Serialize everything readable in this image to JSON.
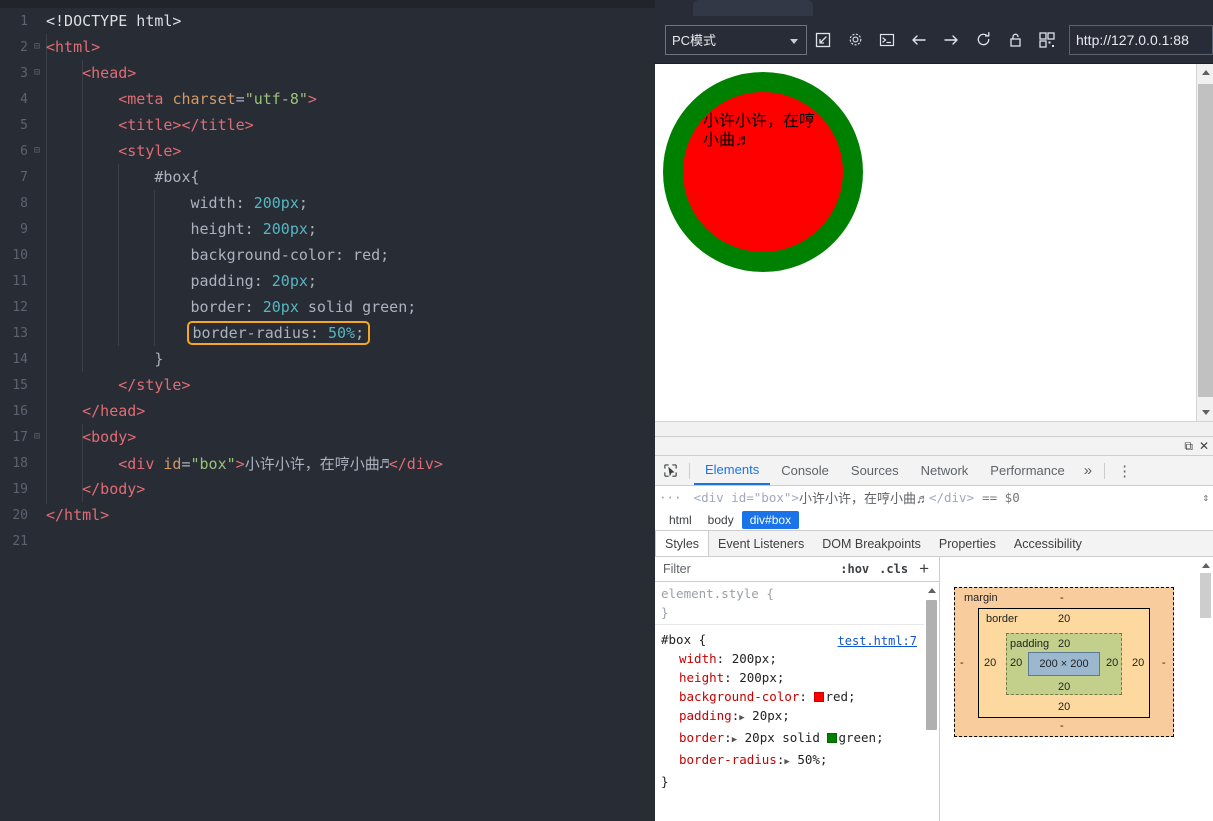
{
  "editor": {
    "lines": [
      {
        "n": "1",
        "fold": "",
        "html": "<span class=\"t-white\">&lt;!DOCTYPE html&gt;</span>"
      },
      {
        "n": "2",
        "fold": "⊟",
        "html": "<span class=\"t-tag\">&lt;html&gt;</span>"
      },
      {
        "n": "3",
        "fold": "⊟",
        "html": "    <span class=\"t-tag\">&lt;head&gt;</span>"
      },
      {
        "n": "4",
        "fold": "",
        "html": "        <span class=\"t-tag\">&lt;meta </span><span class=\"t-attr\">charset</span><span class=\"t-plain\">=</span><span class=\"t-str\">\"utf-8\"</span><span class=\"t-tag\">&gt;</span>"
      },
      {
        "n": "5",
        "fold": "",
        "html": "        <span class=\"t-tag\">&lt;title&gt;&lt;/title&gt;</span>"
      },
      {
        "n": "6",
        "fold": "⊟",
        "html": "        <span class=\"t-tag\">&lt;style&gt;</span>"
      },
      {
        "n": "7",
        "fold": "",
        "html": "            <span class=\"t-plain\">#box{</span>"
      },
      {
        "n": "8",
        "fold": "",
        "html": "                <span class=\"t-plain\">width: </span><span class=\"t-num\">200px</span><span class=\"t-plain\">;</span>"
      },
      {
        "n": "9",
        "fold": "",
        "html": "                <span class=\"t-plain\">height: </span><span class=\"t-num\">200px</span><span class=\"t-plain\">;</span>"
      },
      {
        "n": "10",
        "fold": "",
        "html": "                <span class=\"t-plain\">background-color: red;</span>"
      },
      {
        "n": "11",
        "fold": "",
        "html": "                <span class=\"t-plain\">padding: </span><span class=\"t-num\">20px</span><span class=\"t-plain\">;</span>"
      },
      {
        "n": "12",
        "fold": "",
        "html": "                <span class=\"t-plain\">border: </span><span class=\"t-num\">20px</span><span class=\"t-plain\"> solid green;</span>"
      },
      {
        "n": "13",
        "fold": "",
        "html": "                <span class=\"hl-box\"><span class=\"t-plain\">border-radius: </span><span class=\"t-num\">50%</span><span class=\"t-plain\">;</span></span>"
      },
      {
        "n": "14",
        "fold": "",
        "html": "            <span class=\"t-plain\">}</span>"
      },
      {
        "n": "15",
        "fold": "",
        "html": "        <span class=\"t-tag\">&lt;/style&gt;</span>"
      },
      {
        "n": "16",
        "fold": "",
        "html": "    <span class=\"t-tag\">&lt;/head&gt;</span>"
      },
      {
        "n": "17",
        "fold": "⊟",
        "html": "    <span class=\"t-tag\">&lt;body&gt;</span>"
      },
      {
        "n": "18",
        "fold": "",
        "html": "        <span class=\"t-tag\">&lt;div </span><span class=\"t-attr\">id</span><span class=\"t-plain\">=</span><span class=\"t-str\">\"box\"</span><span class=\"t-tag\">&gt;</span><span class=\"t-cn\">小许小许，在哼小曲♬</span><span class=\"t-tag\">&lt;/div&gt;</span>"
      },
      {
        "n": "19",
        "fold": "",
        "html": "    <span class=\"t-tag\">&lt;/body&gt;</span>"
      },
      {
        "n": "20",
        "fold": "",
        "html": "<span class=\"t-tag\">&lt;/html&gt;</span>"
      },
      {
        "n": "21",
        "fold": "",
        "html": ""
      }
    ]
  },
  "browser": {
    "mode_select": "PC模式",
    "url": "http://127.0.0.1:88",
    "toolbar_icons": [
      "popout-window-icon",
      "gear-icon",
      "console-icon",
      "back-arrow-icon",
      "forward-arrow-icon",
      "reload-icon",
      "lock-icon",
      "qrcode-icon"
    ],
    "page": {
      "box_text": "小许小许，在哼小曲♬",
      "box_bg": "#ff0000",
      "box_border_color": "#008000"
    }
  },
  "devtools": {
    "tabs": [
      {
        "label": "Elements",
        "active": true
      },
      {
        "label": "Console",
        "active": false
      },
      {
        "label": "Sources",
        "active": false
      },
      {
        "label": "Network",
        "active": false
      },
      {
        "label": "Performance",
        "active": false
      }
    ],
    "more_label": "»",
    "kebab_label": "⋮",
    "dom_row": {
      "dots": "···",
      "open_tag": "<div id=\"box\">",
      "text": "小许小许，在哼小曲♬",
      "close_tag": "</div>",
      "eq": "== $0"
    },
    "breadcrumbs": [
      {
        "label": "html",
        "selected": false
      },
      {
        "label": "body",
        "selected": false
      },
      {
        "label": "div#box",
        "selected": true
      }
    ],
    "panel_tabs": [
      {
        "label": "Styles",
        "active": true
      },
      {
        "label": "Event Listeners",
        "active": false
      },
      {
        "label": "DOM Breakpoints",
        "active": false
      },
      {
        "label": "Properties",
        "active": false
      },
      {
        "label": "Accessibility",
        "active": false
      }
    ],
    "filter": {
      "placeholder": "Filter",
      "hov": ":hov",
      "cls": ".cls",
      "plus": "+"
    },
    "styles": {
      "element_style_open": "element.style {",
      "element_style_close": "}",
      "rule_selector": "#box {",
      "rule_source": "test.html:7",
      "rule_close": "}",
      "declarations": [
        {
          "prop": "width",
          "value": "200px;",
          "swatch": "",
          "tri": false
        },
        {
          "prop": "height",
          "value": "200px;",
          "swatch": "",
          "tri": false
        },
        {
          "prop": "background-color",
          "value": "red;",
          "swatch": "#ff0000",
          "tri": false
        },
        {
          "prop": "padding",
          "value": "20px;",
          "swatch": "",
          "tri": true
        },
        {
          "prop": "border",
          "value": "20px solid",
          "value2": "green;",
          "swatch": "#008000",
          "tri": true
        },
        {
          "prop": "border-radius",
          "value": "50%;",
          "swatch": "",
          "tri": true
        }
      ]
    },
    "box_model": {
      "margin_label": "margin",
      "border_label": "border",
      "padding_label": "padding",
      "content_size": "200 × 200",
      "margin_top": "-",
      "margin_right": "-",
      "margin_bottom": "-",
      "margin_left": "-",
      "border_top": "20",
      "border_right": "20",
      "border_bottom": "20",
      "border_left": "20",
      "padding_top": "20",
      "padding_right": "20",
      "padding_bottom": "20",
      "padding_left": "20"
    },
    "window_buttons": {
      "dock": "⧉",
      "close": "✕"
    }
  }
}
